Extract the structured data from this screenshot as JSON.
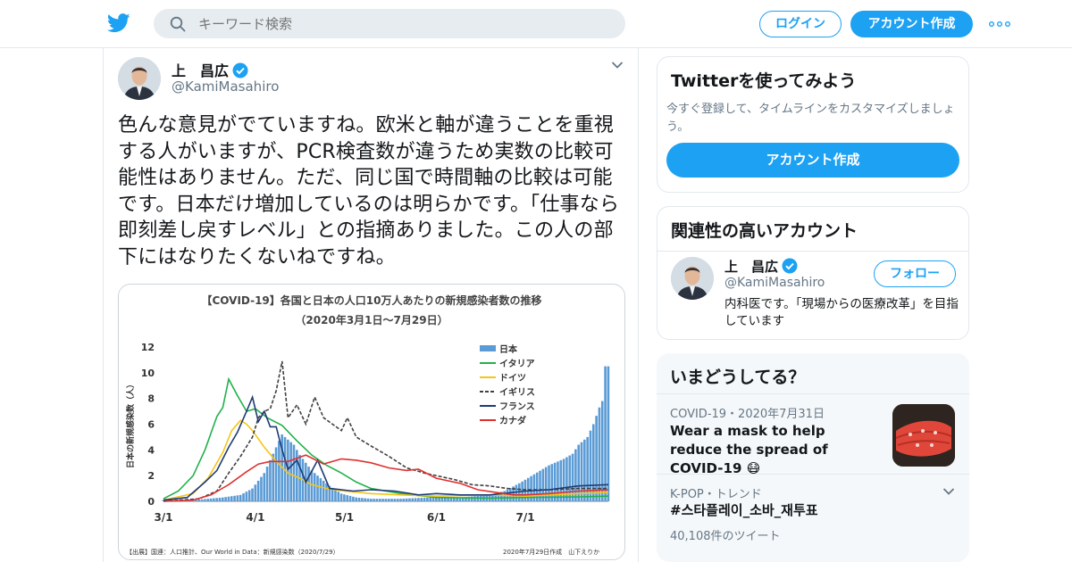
{
  "search": {
    "placeholder": "キーワード検索"
  },
  "header": {
    "login_label": "ログイン",
    "signup_label": "アカウント作成"
  },
  "tweet": {
    "author_name": "上　昌広",
    "author_handle": "@KamiMasahiro",
    "text": "色んな意見がでていますね。欧米と軸が違うことを重視する人がいますが、PCR検査数が違うため実数の比較可能性はありません。ただ、同じ国で時間軸の比較は可能です。日本だけ増加しているのは明らかです。「仕事なら即刻差し戻すレベル」との指摘ありました。この人の部下にはなりたくないねですね。",
    "chart_title_line1": "【COVID-19】各国と日本の人口10万人あたりの新規感染者数の推移",
    "chart_title_line2": "（2020年3月1日～7月29日）",
    "chart_source": "【出展】国連：人口推計、Our World in Data：新規感染数（2020/7/29）",
    "chart_credit": "2020年7月29日作成　山下えりか"
  },
  "chart_data": {
    "type": "line",
    "title": "【COVID-19】各国と日本の人口10万人あたりの新規感染者数の推移",
    "subtitle": "（2020年3月1日～7月29日）",
    "ylabel": "日本の新規感染数（人）",
    "ylim": [
      0,
      12
    ],
    "yticks": [
      0,
      2,
      4,
      6,
      8,
      10,
      12
    ],
    "xticks": [
      "3/1",
      "4/1",
      "5/1",
      "6/1",
      "7/1"
    ],
    "x_days_per_tick": [
      0,
      31,
      61,
      92,
      122
    ],
    "x_max_day": 150,
    "legend_position": "top-right",
    "series": [
      {
        "name": "日本",
        "kind": "bar",
        "color": "#5b9bd5",
        "points": [
          [
            0,
            0.1
          ],
          [
            10,
            0.1
          ],
          [
            20,
            0.3
          ],
          [
            26,
            0.5
          ],
          [
            30,
            1.0
          ],
          [
            34,
            2.2
          ],
          [
            36,
            3.2
          ],
          [
            38,
            4.2
          ],
          [
            40,
            5.2
          ],
          [
            42,
            4.8
          ],
          [
            44,
            4.4
          ],
          [
            46,
            3.6
          ],
          [
            48,
            3.0
          ],
          [
            50,
            2.4
          ],
          [
            52,
            2.0
          ],
          [
            54,
            1.6
          ],
          [
            56,
            1.2
          ],
          [
            58,
            0.9
          ],
          [
            60,
            0.6
          ],
          [
            65,
            0.3
          ],
          [
            70,
            0.2
          ],
          [
            80,
            0.2
          ],
          [
            90,
            0.3
          ],
          [
            100,
            0.3
          ],
          [
            110,
            0.5
          ],
          [
            115,
            0.8
          ],
          [
            120,
            1.4
          ],
          [
            125,
            2.1
          ],
          [
            130,
            2.8
          ],
          [
            135,
            3.3
          ],
          [
            138,
            3.7
          ],
          [
            140,
            4.4
          ],
          [
            143,
            5.0
          ],
          [
            145,
            6.0
          ],
          [
            147,
            7.3
          ],
          [
            148,
            7.8
          ],
          [
            149,
            10.5
          ]
        ]
      },
      {
        "name": "イタリア",
        "kind": "line",
        "color": "#22b14c",
        "points": [
          [
            0,
            0.2
          ],
          [
            5,
            0.8
          ],
          [
            10,
            2.0
          ],
          [
            14,
            4.0
          ],
          [
            18,
            6.6
          ],
          [
            20,
            7.3
          ],
          [
            22,
            9.5
          ],
          [
            25,
            8.2
          ],
          [
            28,
            7.0
          ],
          [
            31,
            7.2
          ],
          [
            35,
            6.5
          ],
          [
            40,
            5.9
          ],
          [
            45,
            4.7
          ],
          [
            50,
            3.6
          ],
          [
            55,
            2.8
          ],
          [
            60,
            2.2
          ],
          [
            65,
            1.5
          ],
          [
            70,
            1.0
          ],
          [
            80,
            0.6
          ],
          [
            92,
            0.3
          ],
          [
            110,
            0.25
          ],
          [
            122,
            0.3
          ],
          [
            140,
            0.35
          ],
          [
            150,
            0.4
          ]
        ]
      },
      {
        "name": "ドイツ",
        "kind": "line",
        "color": "#f5c518",
        "points": [
          [
            0,
            0.1
          ],
          [
            10,
            0.6
          ],
          [
            15,
            1.8
          ],
          [
            20,
            3.8
          ],
          [
            23,
            5.5
          ],
          [
            26,
            6.3
          ],
          [
            28,
            6.0
          ],
          [
            30,
            5.5
          ],
          [
            34,
            4.2
          ],
          [
            38,
            3.1
          ],
          [
            42,
            2.2
          ],
          [
            46,
            1.8
          ],
          [
            50,
            1.3
          ],
          [
            55,
            1.0
          ],
          [
            61,
            0.8
          ],
          [
            70,
            0.6
          ],
          [
            80,
            0.5
          ],
          [
            92,
            0.4
          ],
          [
            110,
            0.5
          ],
          [
            122,
            0.4
          ],
          [
            140,
            0.6
          ],
          [
            150,
            0.7
          ]
        ]
      },
      {
        "name": "イギリス",
        "kind": "line",
        "color": "#404040",
        "dashed": true,
        "points": [
          [
            0,
            0
          ],
          [
            12,
            0.2
          ],
          [
            18,
            0.8
          ],
          [
            22,
            2.2
          ],
          [
            26,
            3.5
          ],
          [
            30,
            5.0
          ],
          [
            32,
            6.5
          ],
          [
            34,
            7.0
          ],
          [
            36,
            7.2
          ],
          [
            38,
            8.6
          ],
          [
            40,
            10.9
          ],
          [
            42,
            6.5
          ],
          [
            45,
            7.5
          ],
          [
            48,
            6.0
          ],
          [
            51,
            8.1
          ],
          [
            54,
            6.5
          ],
          [
            57,
            6.0
          ],
          [
            60,
            5.5
          ],
          [
            62,
            6.5
          ],
          [
            65,
            5.0
          ],
          [
            70,
            4.3
          ],
          [
            76,
            3.5
          ],
          [
            82,
            2.6
          ],
          [
            88,
            2.2
          ],
          [
            92,
            2.0
          ],
          [
            98,
            1.7
          ],
          [
            104,
            1.3
          ],
          [
            110,
            1.2
          ],
          [
            116,
            1.0
          ],
          [
            122,
            0.9
          ],
          [
            130,
            0.9
          ],
          [
            140,
            1.0
          ],
          [
            150,
            1.0
          ]
        ]
      },
      {
        "name": "フランス",
        "kind": "line",
        "color": "#1f3b73",
        "points": [
          [
            0,
            0.1
          ],
          [
            8,
            0.3
          ],
          [
            14,
            1.5
          ],
          [
            18,
            2.4
          ],
          [
            22,
            4.2
          ],
          [
            25,
            5.4
          ],
          [
            28,
            7.0
          ],
          [
            30,
            8.1
          ],
          [
            32,
            6.2
          ],
          [
            34,
            7.0
          ],
          [
            36,
            5.8
          ],
          [
            38,
            5.8
          ],
          [
            40,
            4.0
          ],
          [
            42,
            2.5
          ],
          [
            45,
            3.2
          ],
          [
            48,
            1.5
          ],
          [
            52,
            3.2
          ],
          [
            56,
            1.0
          ],
          [
            60,
            0.9
          ],
          [
            64,
            0.8
          ],
          [
            70,
            0.9
          ],
          [
            78,
            0.8
          ],
          [
            86,
            0.5
          ],
          [
            92,
            0.6
          ],
          [
            100,
            0.5
          ],
          [
            110,
            0.5
          ],
          [
            122,
            0.8
          ],
          [
            130,
            0.9
          ],
          [
            140,
            1.2
          ],
          [
            150,
            1.3
          ]
        ]
      },
      {
        "name": "カナダ",
        "kind": "line",
        "color": "#e03030",
        "points": [
          [
            0,
            0
          ],
          [
            10,
            0.1
          ],
          [
            16,
            0.5
          ],
          [
            22,
            1.3
          ],
          [
            28,
            2.3
          ],
          [
            32,
            2.9
          ],
          [
            36,
            3.1
          ],
          [
            42,
            3.1
          ],
          [
            48,
            3.6
          ],
          [
            54,
            2.9
          ],
          [
            60,
            3.3
          ],
          [
            65,
            3.2
          ],
          [
            70,
            3.0
          ],
          [
            76,
            2.6
          ],
          [
            82,
            2.4
          ],
          [
            86,
            2.5
          ],
          [
            92,
            1.8
          ],
          [
            100,
            1.4
          ],
          [
            106,
            0.9
          ],
          [
            112,
            0.7
          ],
          [
            118,
            0.5
          ],
          [
            122,
            0.5
          ],
          [
            130,
            0.6
          ],
          [
            140,
            0.8
          ],
          [
            150,
            0.9
          ]
        ]
      }
    ]
  },
  "sidebar": {
    "signup_card": {
      "title": "Twitterを使ってみよう",
      "subtitle": "今すぐ登録して、タイムラインをカスタマイズしましょう。",
      "button_label": "アカウント作成"
    },
    "related_card": {
      "title": "関連性の高いアカウント",
      "name": "上　昌広",
      "handle": "@KamiMasahiro",
      "follow_label": "フォロー",
      "bio": "内科医です。「現場からの医療改革」を目指しています"
    },
    "trends_card": {
      "title": "いまどうしてる？",
      "items": [
        {
          "meta": "COVID-19・2020年7月31日",
          "name": "Wear a mask to help reduce the spread of COVID-19 😷"
        },
        {
          "meta": "K-POP・トレンド",
          "name": "#스타플레이_소바_재투표",
          "count": "40,108件のツイート"
        }
      ]
    }
  }
}
